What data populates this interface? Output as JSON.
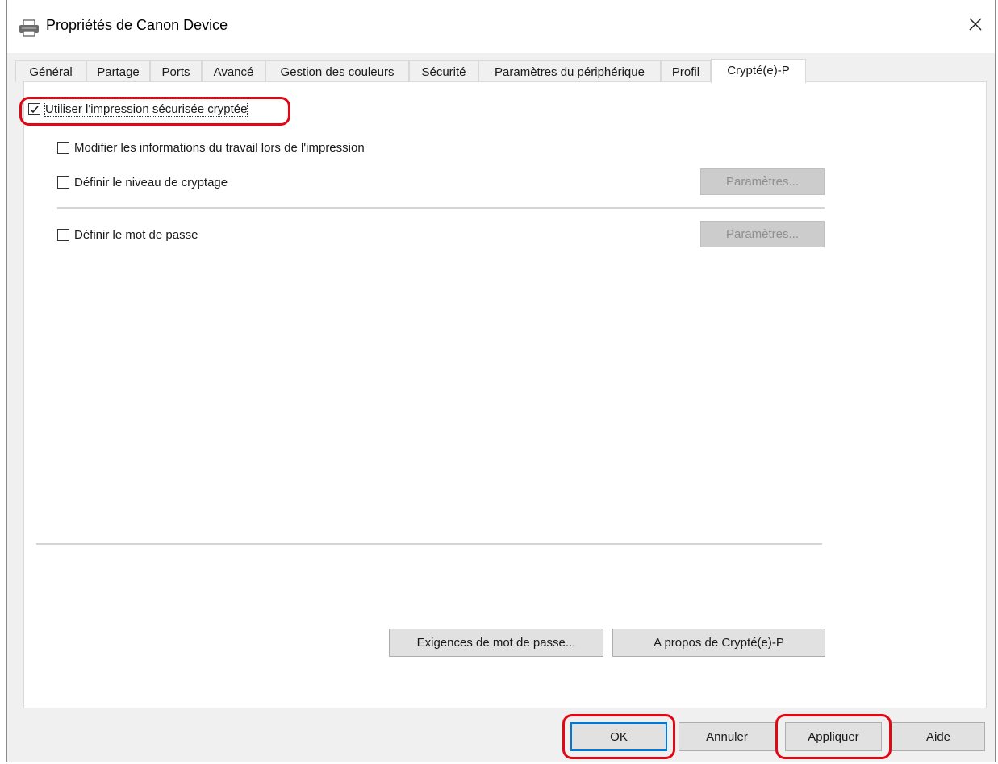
{
  "window": {
    "title": "Propriétés de Canon Device",
    "close_label": "×"
  },
  "tabs": [
    {
      "label": "Général"
    },
    {
      "label": "Partage"
    },
    {
      "label": "Ports"
    },
    {
      "label": "Avancé"
    },
    {
      "label": "Gestion des couleurs"
    },
    {
      "label": "Sécurité"
    },
    {
      "label": "Paramètres du périphérique"
    },
    {
      "label": "Profil"
    },
    {
      "label": "Crypté(e)-P",
      "active": true
    }
  ],
  "options": {
    "use_secure_print": {
      "label": "Utiliser l'impression sécurisée cryptée",
      "checked": true
    },
    "modify_job_info": {
      "label": "Modifier les informations du travail lors de l'impression",
      "checked": false
    },
    "set_encryption_level": {
      "label": "Définir le niveau de cryptage",
      "checked": false
    },
    "set_password": {
      "label": "Définir le mot de passe",
      "checked": false
    }
  },
  "buttons": {
    "encryption_settings": "Paramètres...",
    "password_settings": "Paramètres...",
    "password_requirements": "Exigences de mot de passe...",
    "about": "A propos de Crypté(e)-P",
    "ok": "OK",
    "cancel": "Annuler",
    "apply": "Appliquer",
    "help": "Aide"
  },
  "colors": {
    "highlight": "#e30613",
    "default_button_border": "#0078d7"
  }
}
